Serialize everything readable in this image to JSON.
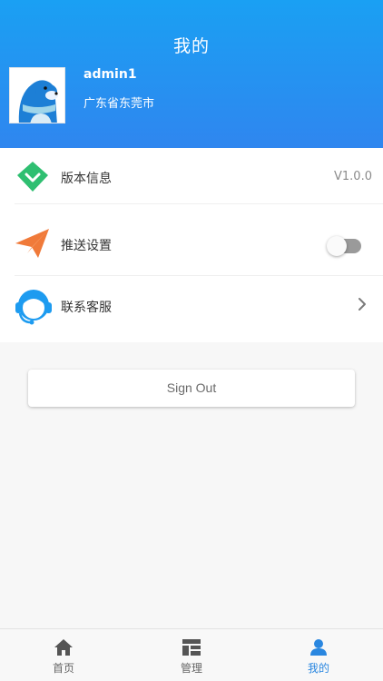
{
  "header": {
    "title": "我的",
    "username": "admin1",
    "location": "广东省东莞市"
  },
  "menu": [
    {
      "label": "版本信息",
      "value": "V1.0.0",
      "icon": "diamond-icon"
    },
    {
      "label": "推送设置",
      "toggle_on": false,
      "icon": "paper-plane-icon"
    },
    {
      "label": "联系客服",
      "icon": "customer-service-icon"
    }
  ],
  "signout_label": "Sign Out",
  "tabbar": [
    {
      "label": "首页",
      "icon": "home-icon"
    },
    {
      "label": "管理",
      "icon": "dashboard-icon"
    },
    {
      "label": "我的",
      "icon": "user-icon",
      "active": true
    }
  ],
  "colors": {
    "header_top": "#1aa0f3",
    "header_bottom": "#2f86ef",
    "active_tab": "#2a87e0",
    "version_icon": "#2fbf71",
    "push_icon": "#f07a3a",
    "service_icon": "#1d9bf0"
  }
}
